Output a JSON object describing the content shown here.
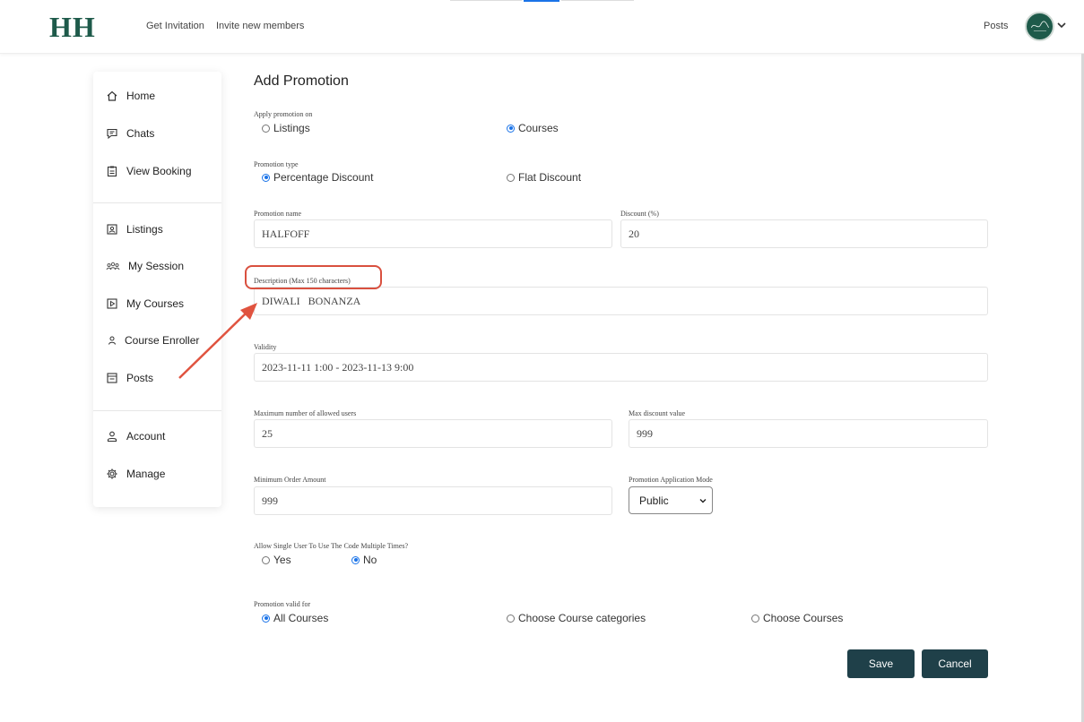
{
  "header": {
    "logo": "HH",
    "nav": [
      "Get Invitation",
      "Invite new members"
    ],
    "posts_link": "Posts"
  },
  "sidebar": {
    "groups": [
      [
        {
          "label": "Home",
          "icon": "home-icon"
        },
        {
          "label": "Chats",
          "icon": "chat-icon"
        },
        {
          "label": "View Booking",
          "icon": "clipboard-icon"
        }
      ],
      [
        {
          "label": "Listings",
          "icon": "listing-icon"
        },
        {
          "label": "My Session",
          "icon": "group-icon"
        },
        {
          "label": "My Courses",
          "icon": "play-icon"
        },
        {
          "label": "Course Enroller",
          "icon": "person-icon"
        },
        {
          "label": "Posts",
          "icon": "posts-icon"
        }
      ],
      [
        {
          "label": "Account",
          "icon": "account-icon"
        },
        {
          "label": "Manage",
          "icon": "gear-icon"
        }
      ]
    ]
  },
  "form": {
    "title": "Add Promotion",
    "apply_on": {
      "label": "Apply promotion on",
      "options": [
        {
          "label": "Listings",
          "selected": false
        },
        {
          "label": "Courses",
          "selected": true
        }
      ]
    },
    "promotion_type": {
      "label": "Promotion type",
      "options": [
        {
          "label": "Percentage Discount",
          "selected": true
        },
        {
          "label": "Flat Discount",
          "selected": false
        }
      ]
    },
    "promotion_name": {
      "label": "Promotion name",
      "value": "HALFOFF"
    },
    "discount": {
      "label": "Discount (%)",
      "value": "20"
    },
    "description": {
      "label": "Description (Max 150 characters)",
      "value": "DIWALI   BONANZA"
    },
    "validity": {
      "label": "Validity",
      "value": "2023-11-11 1:00 - 2023-11-13 9:00"
    },
    "max_users": {
      "label": "Maximum number of allowed users",
      "value": "25"
    },
    "max_discount": {
      "label": "Max discount value",
      "value": "999"
    },
    "min_order": {
      "label": "Minimum Order Amount",
      "value": "999"
    },
    "application_mode": {
      "label": "Promotion Application Mode",
      "value": "Public"
    },
    "multiple_use": {
      "label": "Allow Single User To Use The Code Multiple Times?",
      "options": [
        {
          "label": "Yes",
          "selected": false
        },
        {
          "label": "No",
          "selected": true
        }
      ]
    },
    "valid_for": {
      "label": "Promotion valid for",
      "options": [
        {
          "label": "All Courses",
          "selected": true
        },
        {
          "label": "Choose Course categories",
          "selected": false
        },
        {
          "label": "Choose Courses",
          "selected": false
        }
      ]
    },
    "save_label": "Save",
    "cancel_label": "Cancel"
  },
  "colors": {
    "brand": "#1e5a4a",
    "button": "#1f4049",
    "radio_selected": "#1a73e8",
    "annotation": "#d9503f"
  }
}
